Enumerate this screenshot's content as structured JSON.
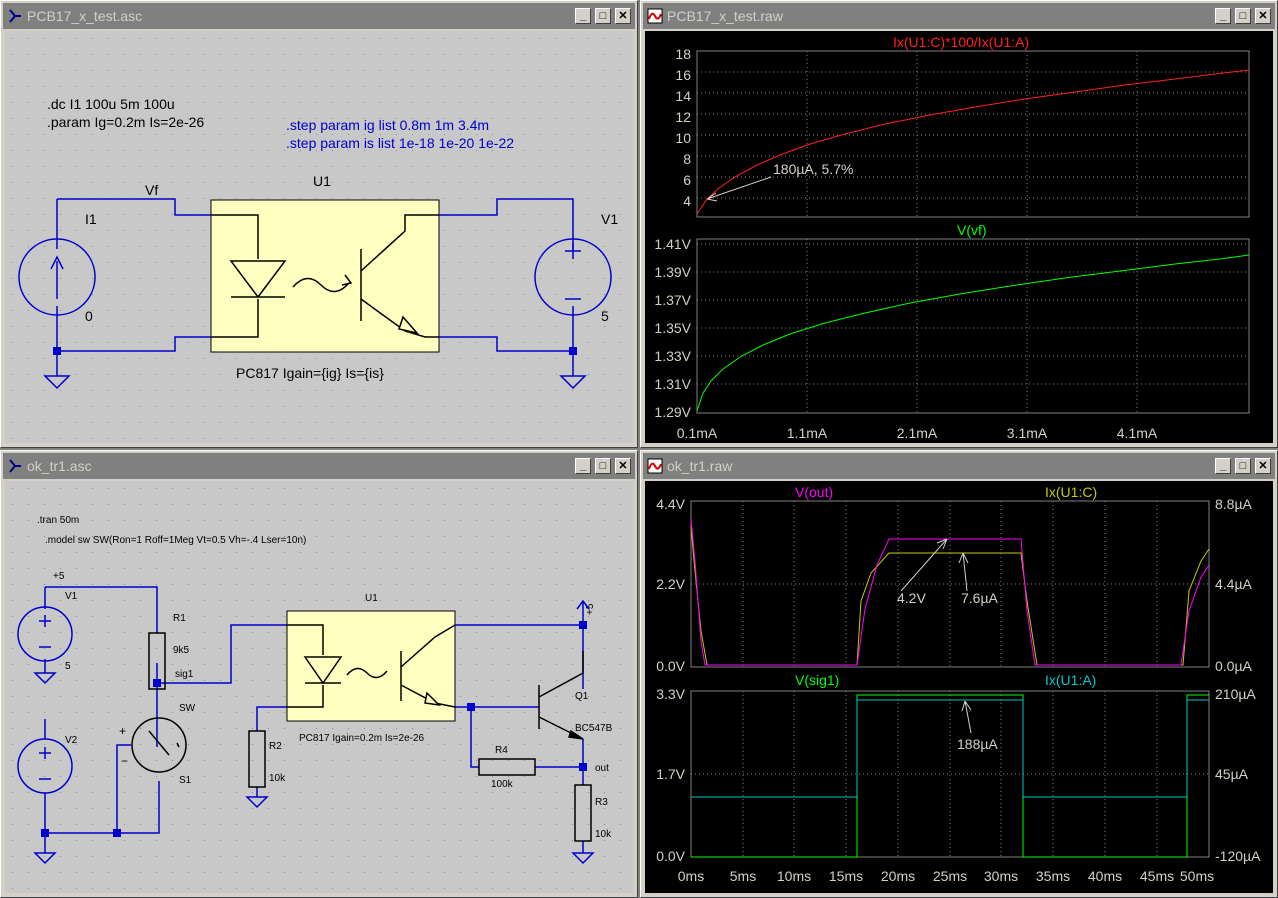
{
  "windows": {
    "sch1": {
      "title": "PCB17_x_test.asc"
    },
    "plot1": {
      "title": "PCB17_x_test.raw"
    },
    "sch2": {
      "title": "ok_tr1.asc"
    },
    "plot2": {
      "title": "ok_tr1.raw"
    }
  },
  "sch1": {
    "dc_cmd": ".dc I1 100u 5m 100u",
    "param_cmd": ".param Ig=0.2m Is=2e-26",
    "step1": ".step param ig list 0.8m 1m 3.4m",
    "step2": ".step param is list 1e-18 1e-20 1e-22",
    "vf_label": "Vf",
    "u1_label": "U1",
    "i1_label": "I1",
    "i1_value": "0",
    "v1_label": "V1",
    "v1_value": "5",
    "part_label": "PC817 Igain={ig} Is={is}"
  },
  "sch2": {
    "tran_cmd": ".tran 50m",
    "model_cmd": ".model sw SW(Ron=1 Roff=1Meg Vt=0.5 Vh=-.4 Lser=10n)",
    "plus5_a": "+5",
    "v1_label": "V1",
    "v1_value": "5",
    "r1_label": "R1",
    "r1_value": "9k5",
    "sig1_label": "sig1",
    "sw_label": "SW",
    "s1_label": "S1",
    "v2_label": "V2",
    "u1_label": "U1",
    "plus5_b": "+5",
    "q1_label": "Q1",
    "q1_value": "BC547B",
    "r2_label": "R2",
    "r2_value": "10k",
    "part_label": "PC817 Igain=0.2m Is=2e-26",
    "r4_label": "R4",
    "r4_value": "100k",
    "out_label": "out",
    "r3_label": "R3",
    "r3_value": "10k"
  },
  "plot1": {
    "top": {
      "trace_label": "Ix(U1:C)*100/Ix(U1:A)",
      "yticks": [
        "18",
        "16",
        "14",
        "12",
        "10",
        "8",
        "6",
        "4"
      ],
      "annotation": "180µA, 5.7%"
    },
    "bottom": {
      "trace_label": "V(vf)",
      "yticks": [
        "1.41V",
        "1.39V",
        "1.37V",
        "1.35V",
        "1.33V",
        "1.31V",
        "1.29V"
      ]
    },
    "xticks": [
      "0.1mA",
      "1.1mA",
      "2.1mA",
      "3.1mA",
      "4.1mA"
    ]
  },
  "plot2": {
    "top": {
      "trace_left": "V(out)",
      "trace_right": "Ix(U1:C)",
      "left_ticks": [
        "4.4V",
        "2.2V",
        "0.0V"
      ],
      "right_ticks": [
        "8.8µA",
        "4.4µA",
        "0.0µA"
      ],
      "ann1": "4.2V",
      "ann2": "7.6µA"
    },
    "bottom": {
      "trace_left": "V(sig1)",
      "trace_right": "Ix(U1:A)",
      "left_ticks": [
        "3.3V",
        "1.7V",
        "0.0V"
      ],
      "right_ticks": [
        "210µA",
        "45µA",
        "-120µA"
      ],
      "ann": "188µA"
    },
    "xticks": [
      "0ms",
      "5ms",
      "10ms",
      "15ms",
      "20ms",
      "25ms",
      "30ms",
      "35ms",
      "40ms",
      "45ms",
      "50ms"
    ]
  },
  "colors": {
    "wire": "#0000cc",
    "component": "#ffffc0",
    "red_trace": "#ff2020",
    "green_trace": "#00ff00",
    "magenta_trace": "#ff00ff",
    "yellow_trace": "#c8c800",
    "cyan_trace": "#00c8c8"
  }
}
